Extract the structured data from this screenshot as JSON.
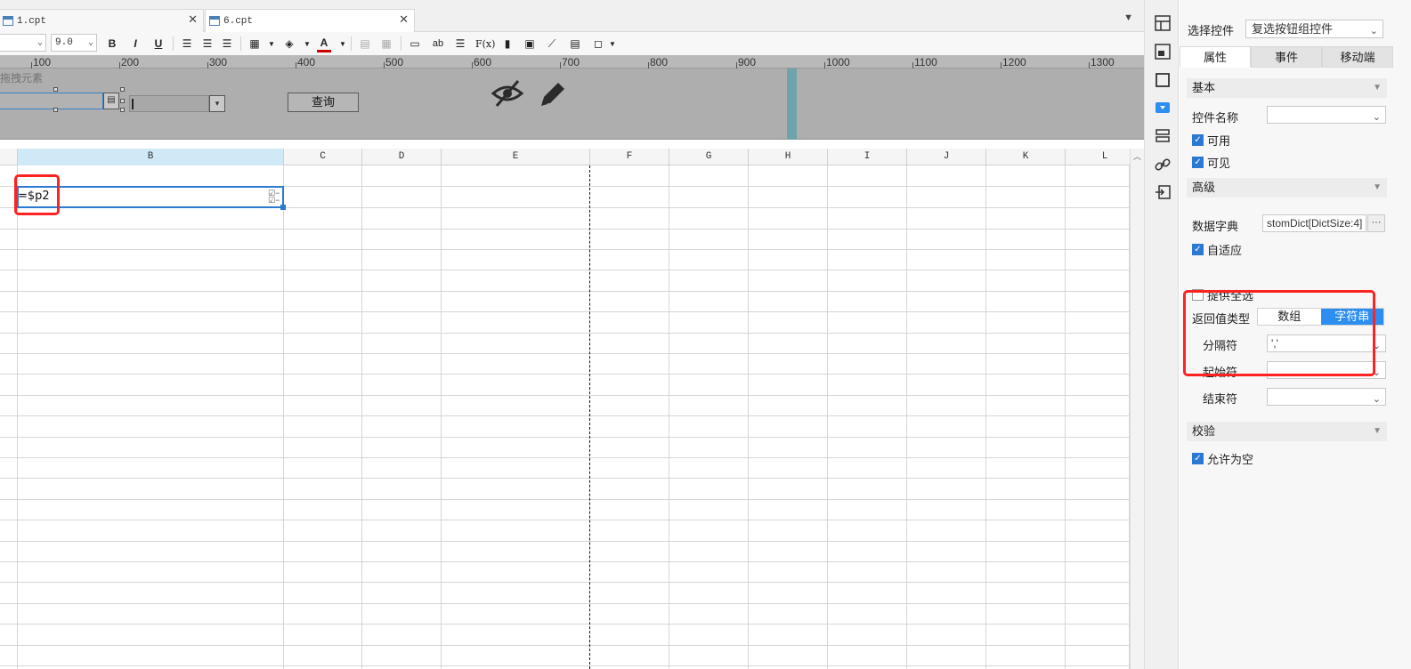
{
  "tabs": [
    {
      "label": "1.cpt",
      "close": "✕"
    },
    {
      "label": "6.cpt",
      "close": "✕"
    }
  ],
  "toolbar": {
    "font_size": "9.0",
    "bold": "B",
    "italic": "I",
    "underline": "U",
    "fx": "F(x)",
    "ab": "ab",
    "font_color": "A"
  },
  "ruler": {
    "ticks": [
      "100",
      "200",
      "300",
      "400",
      "500",
      "600",
      "700",
      "800",
      "900",
      "1000",
      "1100",
      "1200",
      "1300"
    ]
  },
  "param_pane": {
    "hint": "拖拽元素",
    "query_button": "查询"
  },
  "grid": {
    "columns": [
      "B",
      "C",
      "D",
      "E",
      "F",
      "G",
      "H",
      "I",
      "J",
      "K",
      "L"
    ],
    "selected_column": "B",
    "selected_cell_formula": "=$p2"
  },
  "panel": {
    "select_widget_label": "选择控件",
    "select_widget_value": "复选按钮组控件",
    "tabs": [
      "属性",
      "事件",
      "移动端"
    ],
    "active_tab": "属性",
    "section_basic": "基本",
    "widget_name_label": "控件名称",
    "widget_name_value": "",
    "enabled_label": "可用",
    "visible_label": "可见",
    "section_advanced": "高级",
    "data_dict_label": "数据字典",
    "data_dict_value": "stomDict[DictSize:4]",
    "data_dict_more": "···",
    "autofit_label": "自适应",
    "select_all_label": "提供全选",
    "return_type_label": "返回值类型",
    "return_type_options": [
      "数组",
      "字符串"
    ],
    "return_type_selected": "字符串",
    "delimiter_label": "分隔符",
    "delimiter_value": "','",
    "start_char_label": "起始符",
    "start_char_value": "",
    "end_char_label": "结束符",
    "end_char_value": "",
    "section_validation": "校验",
    "allow_empty_label": "允许为空"
  },
  "colors": {
    "accent": "#2c79d4",
    "segment_active": "#2c8ef0",
    "highlight_red": "#ff2222",
    "param_bg": "#aeaeae"
  }
}
